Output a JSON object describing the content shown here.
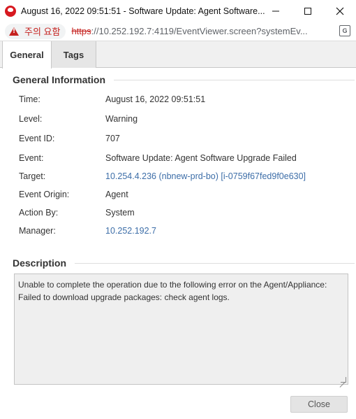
{
  "window": {
    "title": "August 16, 2022 09:51:51 - Software Update: Agent Software...",
    "minimize_glyph": "—",
    "maximize_glyph": "☐",
    "close_glyph": "✕"
  },
  "addressbar": {
    "security_label": "주의 요함",
    "url_scheme": "https",
    "url_rest": "://10.252.192.7:4119/EventViewer.screen?systemEv...",
    "translate_glyph": "G"
  },
  "tabs": [
    {
      "label": "General",
      "active": true
    },
    {
      "label": "Tags",
      "active": false
    }
  ],
  "general": {
    "heading": "General Information",
    "rows": [
      {
        "key": "Time:",
        "value": "August 16, 2022 09:51:51"
      },
      {
        "key": "Level:",
        "value": "Warning"
      },
      {
        "key": "Event ID:",
        "value": "707"
      },
      {
        "key": "Event:",
        "value": "Software Update: Agent Software Upgrade Failed"
      },
      {
        "key": "Target:",
        "value": "10.254.4.236 (nbnew-prd-bo) [i-0759f67fed9f0e630]"
      },
      {
        "key": "Event Origin:",
        "value": "Agent"
      },
      {
        "key": "Action By:",
        "value": "System"
      },
      {
        "key": "Manager:",
        "value": "10.252.192.7"
      }
    ]
  },
  "description": {
    "heading": "Description",
    "line1": "Unable to complete the operation due to the following error on the Agent/Appliance:",
    "line2": "Failed to download upgrade packages: check agent logs."
  },
  "footer": {
    "close_label": "Close"
  },
  "colors": {
    "link": "#3d6ea8",
    "warning": "#c5221f",
    "brand": "#d71920"
  }
}
